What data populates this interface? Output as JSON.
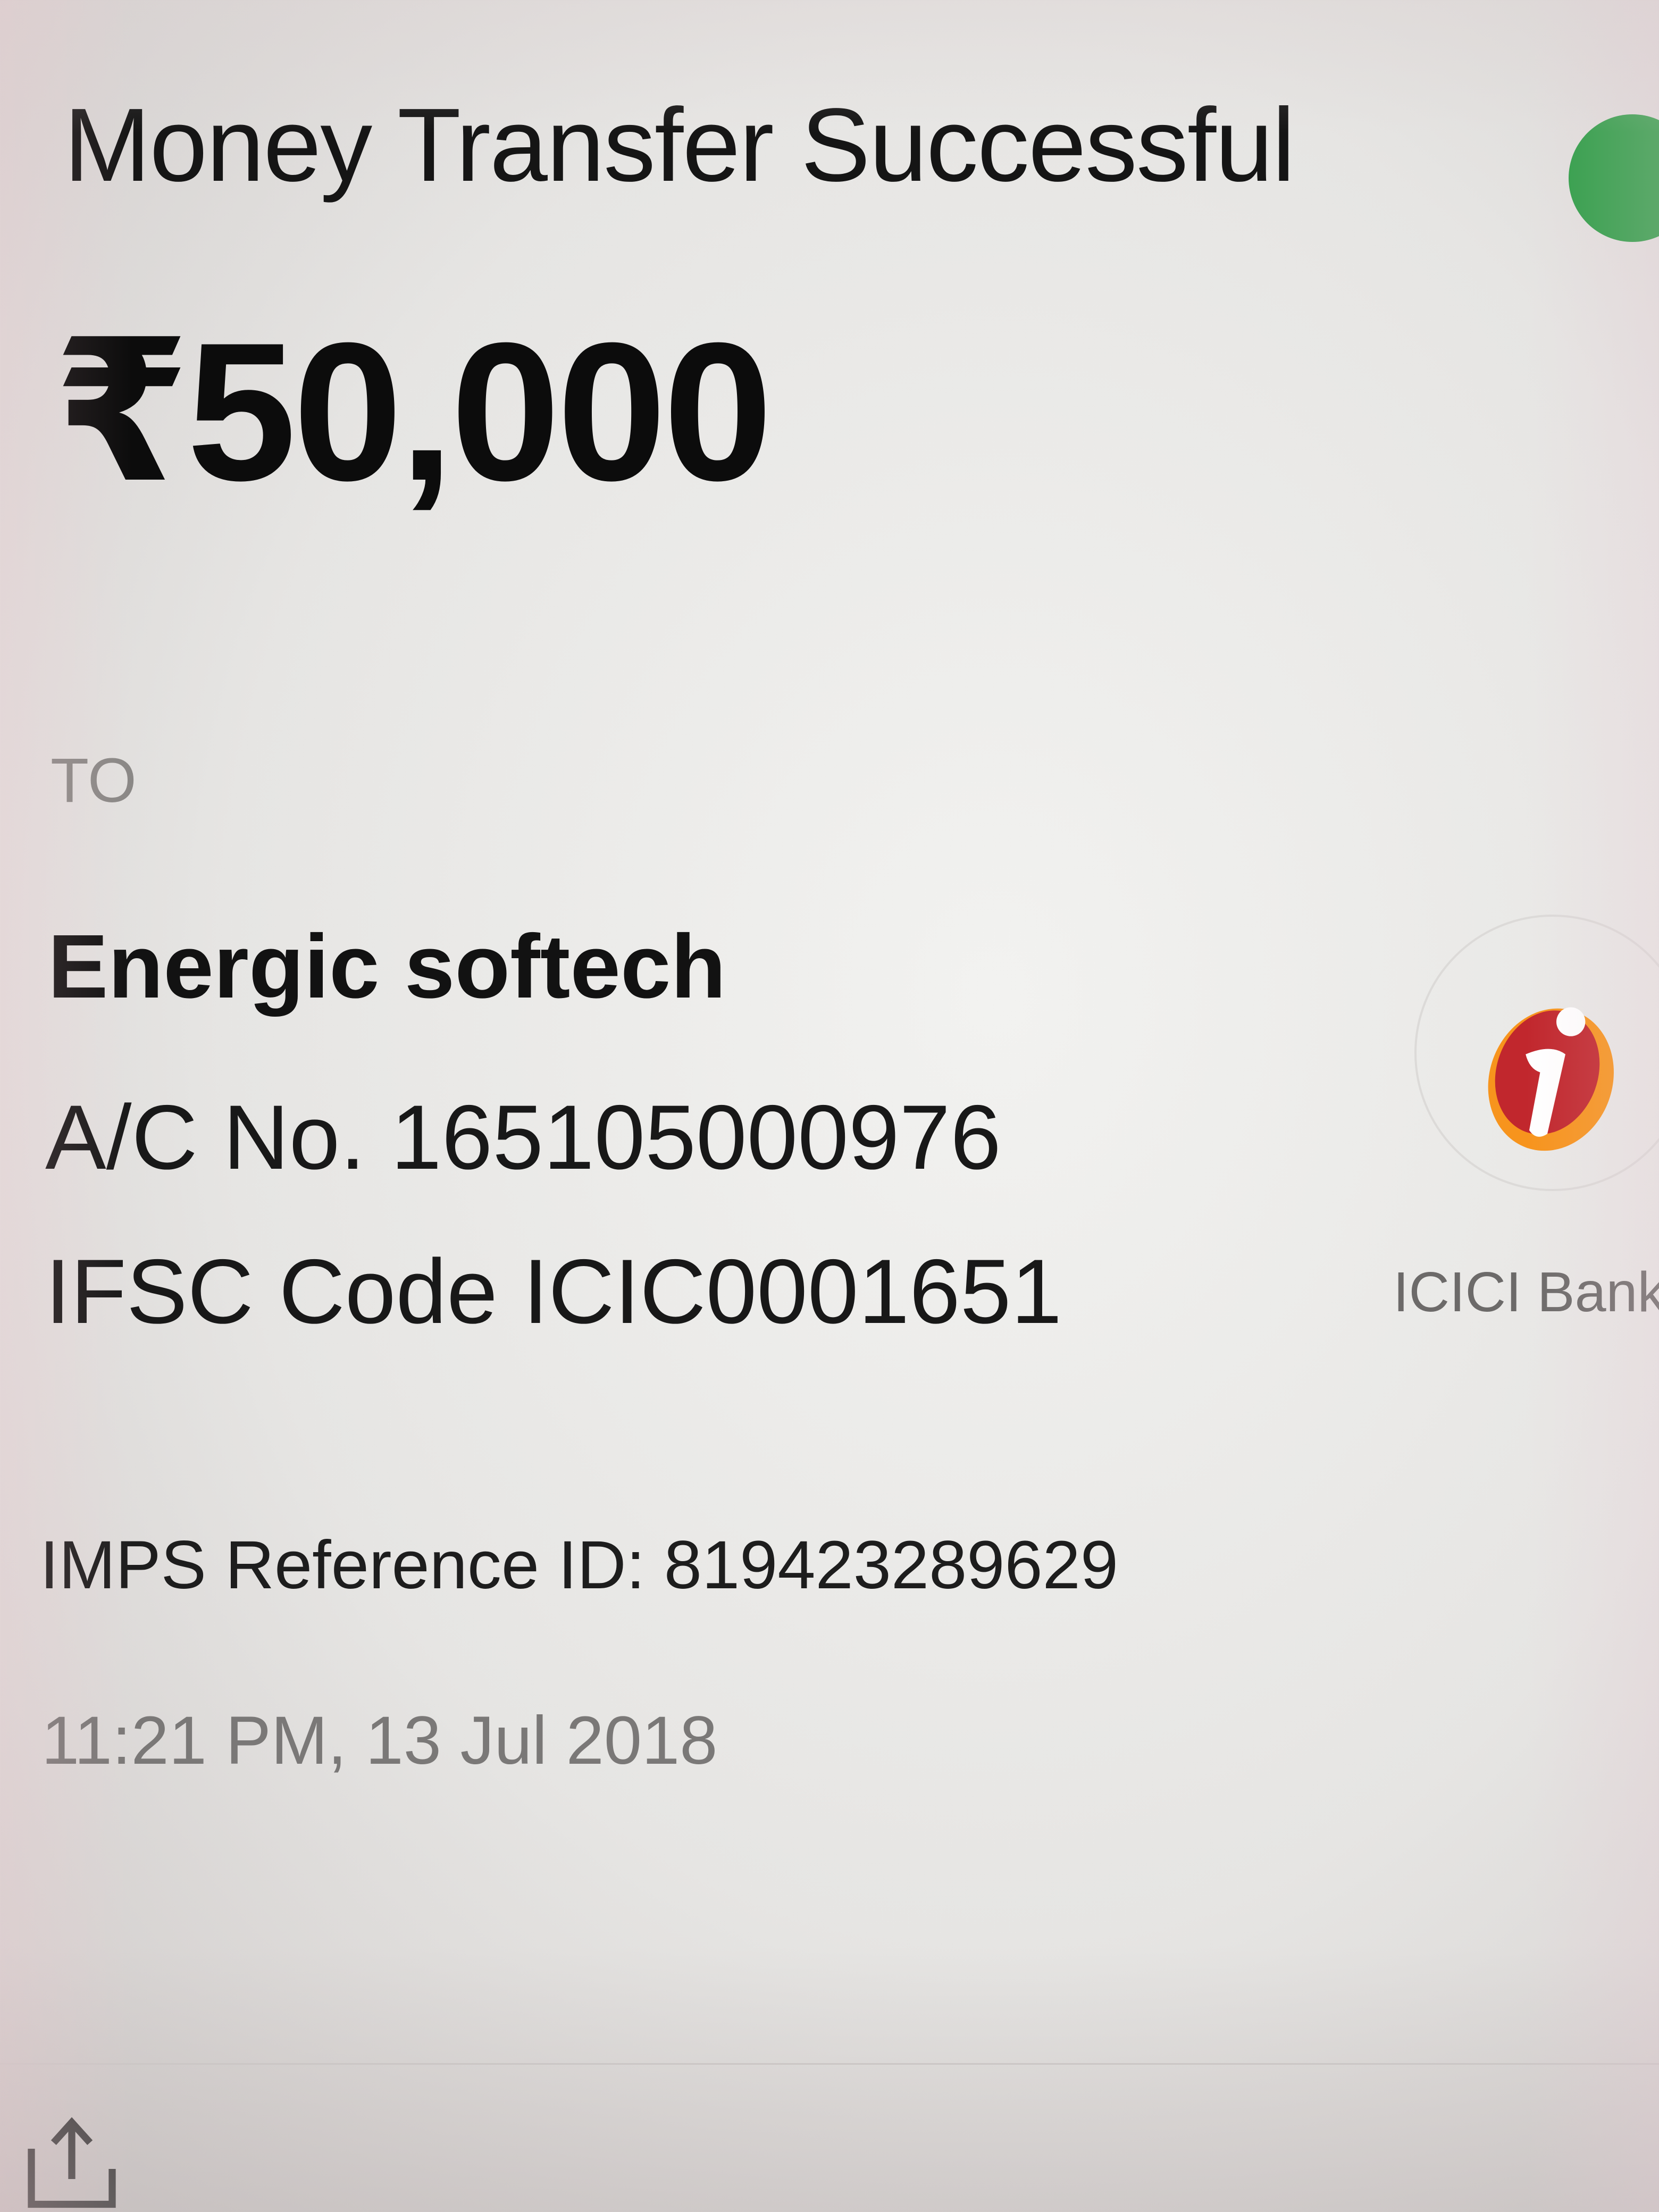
{
  "header": {
    "title": "Money Transfer Successful",
    "status_icon": "check-circle-icon",
    "status_color": "#2e9e47"
  },
  "transaction": {
    "amount": "₹50,000"
  },
  "payee": {
    "to_label": "TO",
    "name": "Energic softech",
    "account_number": "A/C No. 165105000976",
    "ifsc_code": "IFSC Code ICIC0001651",
    "bank_name": "ICICI Bank",
    "bank_logo_icon": "icici-bank-logo",
    "bank_logo_colors": [
      "#c1272d",
      "#f7941d"
    ]
  },
  "reference": {
    "imps_reference": "IMPS Reference ID: 819423289629",
    "timestamp": "11:21 PM, 13 Jul 2018"
  },
  "bottom_action": {
    "icon": "share-icon"
  }
}
